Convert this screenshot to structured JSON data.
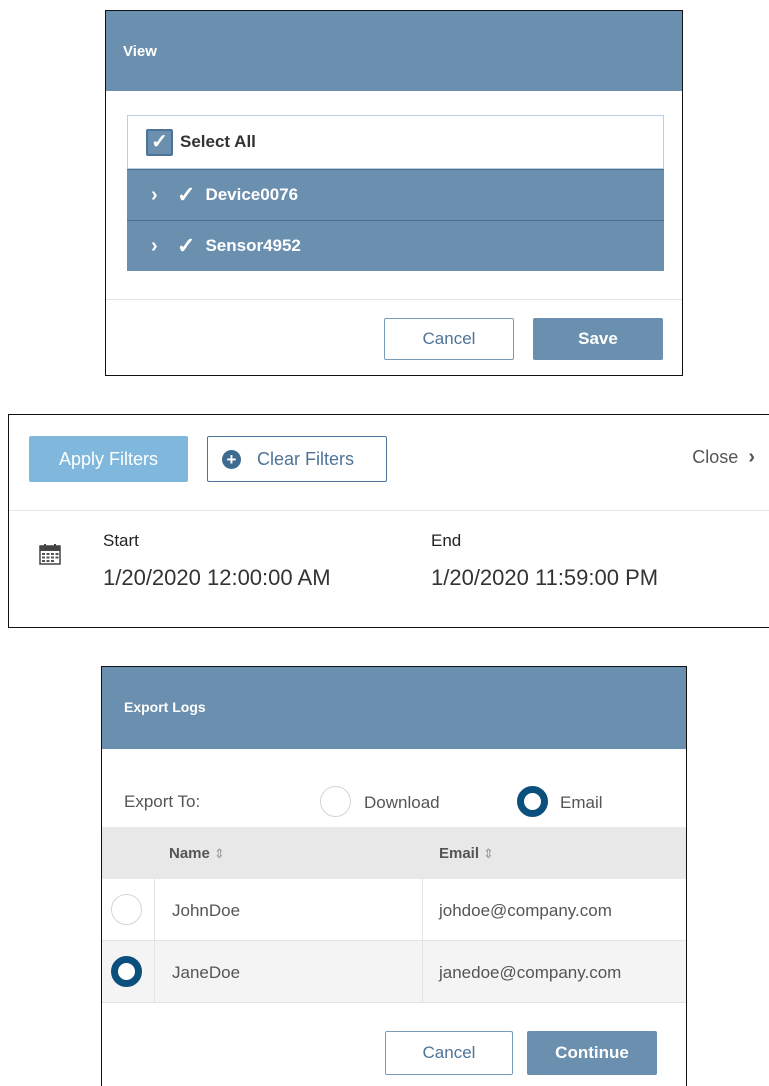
{
  "view_dialog": {
    "title": "View",
    "select_all_label": "Select All",
    "items": [
      {
        "label": "Device0076"
      },
      {
        "label": "Sensor4952"
      }
    ],
    "cancel_label": "Cancel",
    "save_label": "Save"
  },
  "filters": {
    "apply_label": "Apply Filters",
    "clear_label": "Clear Filters",
    "close_label": "Close",
    "start_label": "Start",
    "start_value": "1/20/2020 12:00:00 AM",
    "end_label": "End",
    "end_value": "1/20/2020 11:59:00 PM"
  },
  "export_dialog": {
    "title": "Export Logs",
    "export_to_label": "Export To:",
    "options": [
      {
        "label": "Download",
        "selected": false
      },
      {
        "label": "Email",
        "selected": true
      }
    ],
    "columns": [
      "Name",
      "Email"
    ],
    "rows": [
      {
        "name": "JohnDoe",
        "email": "johdoe@company.com",
        "selected": false
      },
      {
        "name": "JaneDoe",
        "email": "janedoe@company.com",
        "selected": true
      }
    ],
    "cancel_label": "Cancel",
    "continue_label": "Continue"
  },
  "colors": {
    "header": "#6b8fae",
    "apply_button": "#7fb8dc",
    "radio_selected": "#0b4f7c"
  }
}
